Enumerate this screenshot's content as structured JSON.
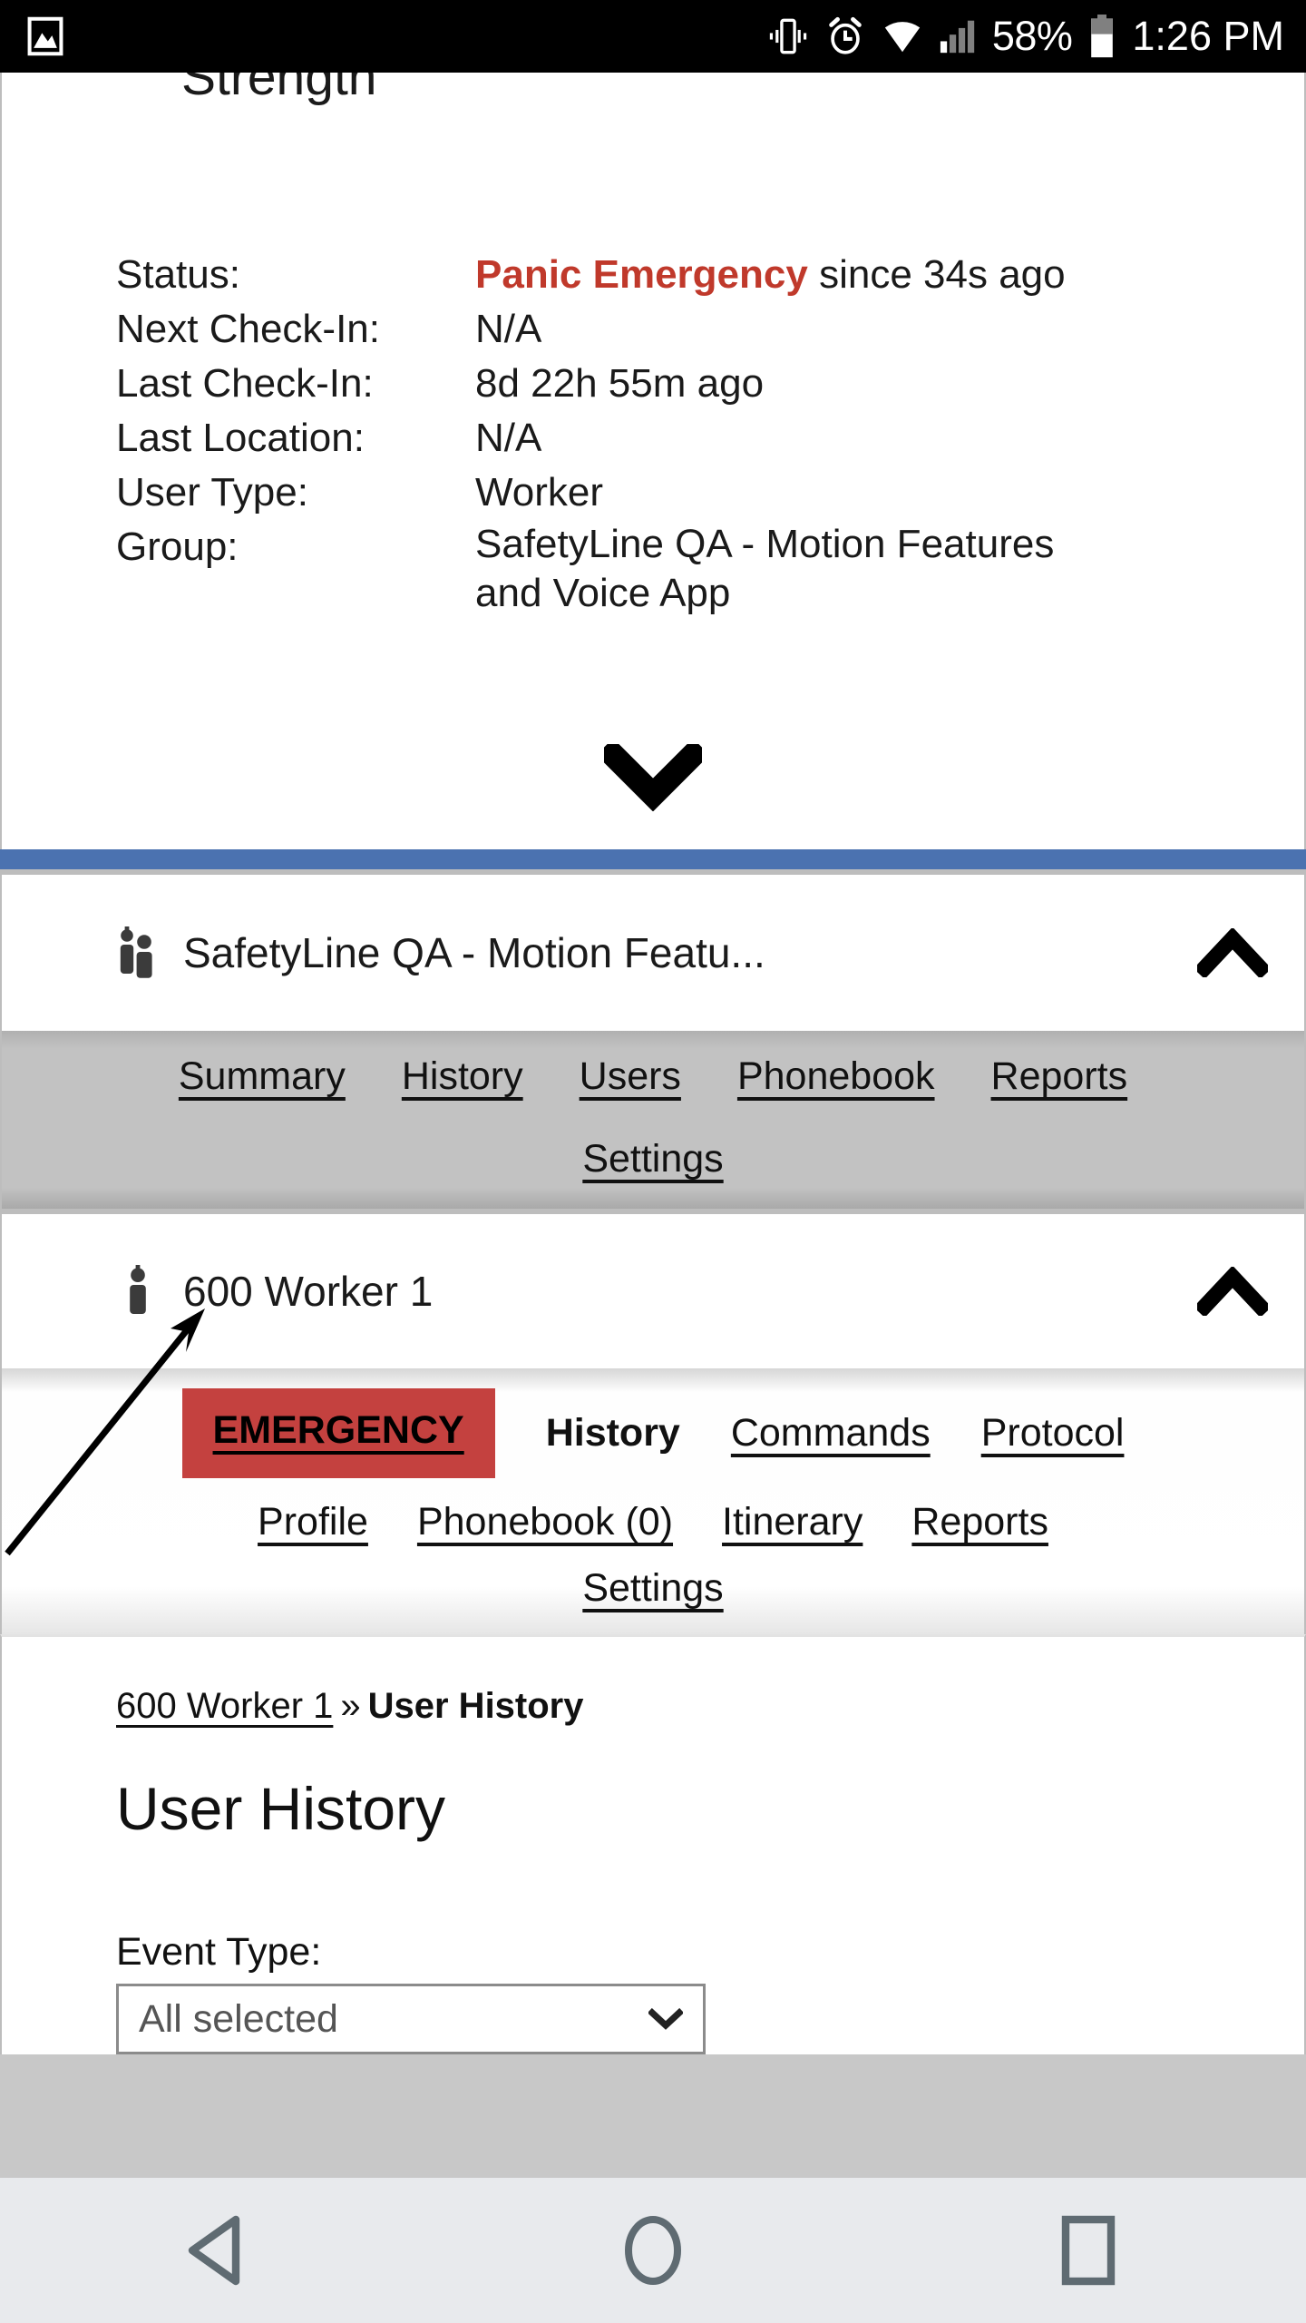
{
  "status_bar": {
    "icons": [
      "photo-icon",
      "vibrate-icon",
      "alarm-icon",
      "wifi-icon",
      "signal-icon",
      "battery-icon"
    ],
    "battery_percent": "58%",
    "time": "1:26 PM"
  },
  "detail_panel": {
    "clipped_heading": "Strength",
    "rows": [
      {
        "label": "Status:",
        "value_strong": "Panic Emergency",
        "value_rest": " since 34s ago"
      },
      {
        "label": "Next Check-In:",
        "value": "N/A"
      },
      {
        "label": "Last Check-In:",
        "value": "8d 22h 55m ago"
      },
      {
        "label": "Last Location:",
        "value": "N/A"
      },
      {
        "label": "User Type:",
        "value": "Worker"
      },
      {
        "label": "Group:",
        "value": "SafetyLine QA - Motion Features\nand Voice App"
      }
    ],
    "expand_icon": "chevron-down-icon"
  },
  "group_section": {
    "icon": "group-people-icon",
    "title": "SafetyLine QA - Motion Featu...",
    "collapse_icon": "chevron-up-icon",
    "tabs_row1": [
      "Summary",
      "History",
      "Users",
      "Phonebook",
      "Reports"
    ],
    "tabs_row2": [
      "Settings"
    ]
  },
  "user_section": {
    "icon": "person-icon",
    "title": "600 Worker 1",
    "collapse_icon": "chevron-up-icon",
    "tabs_row1": [
      {
        "label": "EMERGENCY",
        "style": "emergency"
      },
      {
        "label": "History",
        "style": "active"
      },
      {
        "label": "Commands",
        "style": "link"
      },
      {
        "label": "Protocol",
        "style": "link"
      }
    ],
    "tabs_row2": [
      {
        "label": "Profile",
        "style": "link"
      },
      {
        "label": "Phonebook (0)",
        "style": "link"
      },
      {
        "label": "Itinerary",
        "style": "link"
      },
      {
        "label": "Reports",
        "style": "link"
      }
    ],
    "tabs_row3": [
      {
        "label": "Settings",
        "style": "link"
      }
    ],
    "annotation": "arrow-pointing-to-emergency-tab"
  },
  "body": {
    "breadcrumb_link": "600 Worker 1",
    "breadcrumb_sep": "»",
    "breadcrumb_current": "User History",
    "page_title": "User History",
    "event_type_label": "Event Type:",
    "event_type_value": "All selected",
    "event_type_caret": "chevron-down-icon"
  },
  "nav_bar": {
    "back": "back-triangle-icon",
    "home": "home-circle-icon",
    "recents": "recents-square-icon"
  },
  "colors": {
    "status_red": "#c0392b",
    "emergency_bg": "#c4413f",
    "divider_blue": "#4b72b0",
    "tabbar_gray": "#c2c2c2",
    "nav_bg": "#e8eaed",
    "nav_icon": "#5f6b72"
  }
}
